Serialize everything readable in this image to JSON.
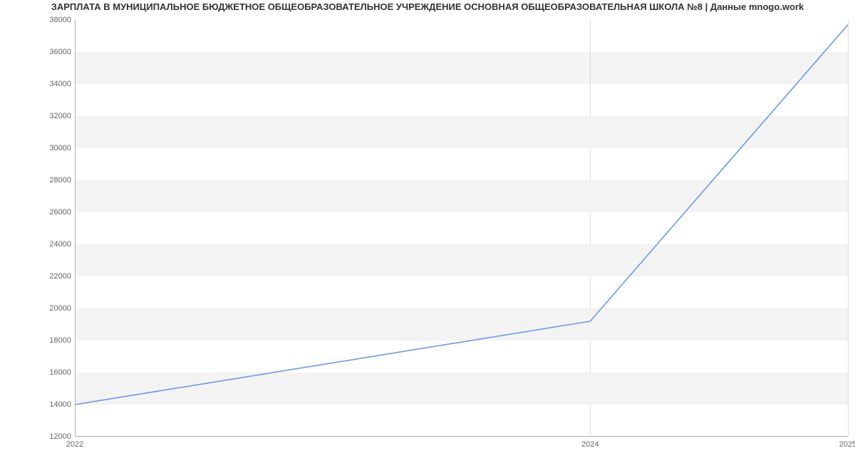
{
  "chart_data": {
    "type": "line",
    "title": "ЗАРПЛАТА В МУНИЦИПАЛЬНОЕ БЮДЖЕТНОЕ ОБЩЕОБРАЗОВАТЕЛЬНОЕ УЧРЕЖДЕНИЕ ОСНОВНАЯ ОБЩЕОБРАЗОВАТЕЛЬНАЯ ШКОЛА №8 | Данные mnogo.work",
    "x": [
      2022,
      2024,
      2025
    ],
    "values": [
      14000,
      19200,
      37700
    ],
    "x_ticks": [
      2022,
      2024,
      2025
    ],
    "y_ticks": [
      12000,
      14000,
      16000,
      18000,
      20000,
      22000,
      24000,
      26000,
      28000,
      30000,
      32000,
      34000,
      36000,
      38000
    ],
    "xlim": [
      2022,
      2025
    ],
    "ylim": [
      12000,
      38000
    ],
    "xlabel": "",
    "ylabel": "",
    "line_color": "#6a9be8",
    "grid": true
  }
}
